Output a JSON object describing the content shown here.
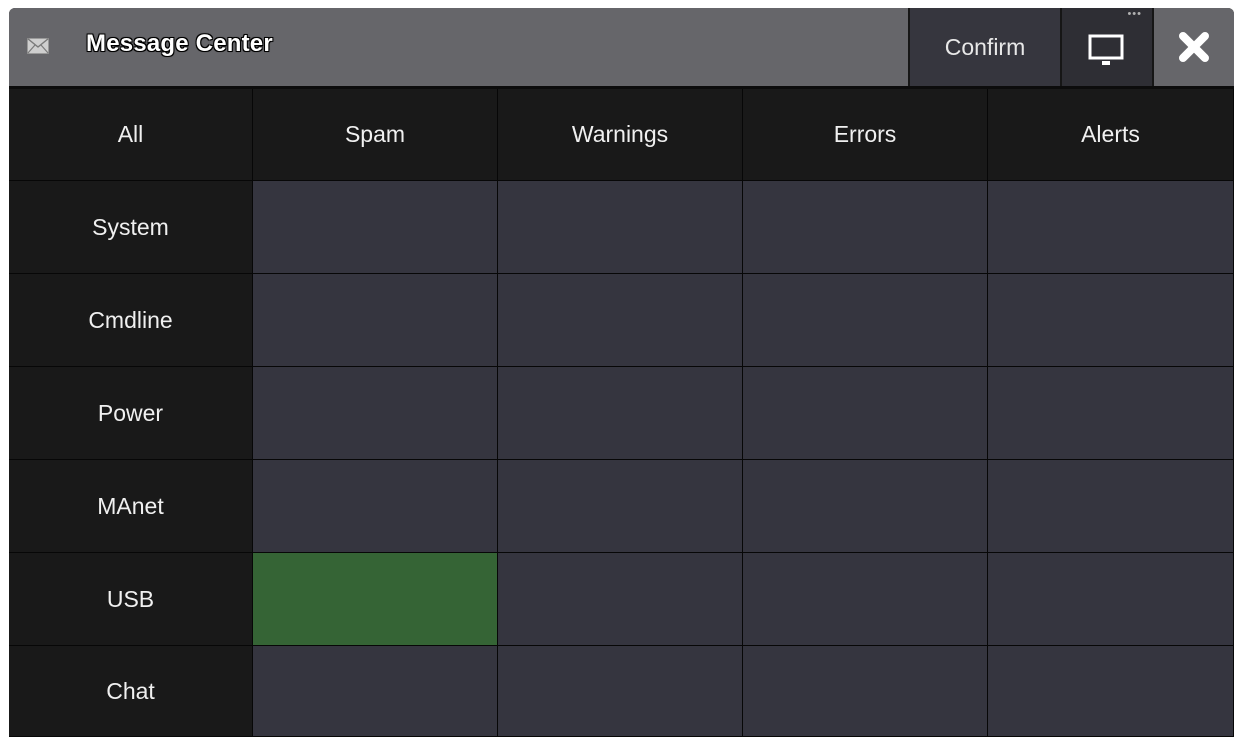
{
  "window": {
    "title": "Message Center",
    "confirm_label": "Confirm",
    "title_icon": "envelope-icon",
    "display_icon": "monitor-icon",
    "close_icon": "close-icon",
    "dots_label": "•••"
  },
  "colors": {
    "titlebar": "#66666a",
    "header_cell": "#191919",
    "value_cell": "#35353f",
    "enabled_cell": "#356435"
  },
  "matrix": {
    "corner_label": "All",
    "columns": [
      "Spam",
      "Warnings",
      "Errors",
      "Alerts"
    ],
    "rows": [
      {
        "label": "System",
        "cells": [
          false,
          false,
          false,
          false
        ]
      },
      {
        "label": "Cmdline",
        "cells": [
          false,
          false,
          false,
          false
        ]
      },
      {
        "label": "Power",
        "cells": [
          false,
          false,
          false,
          false
        ]
      },
      {
        "label": "MAnet",
        "cells": [
          false,
          false,
          false,
          false
        ]
      },
      {
        "label": "USB",
        "cells": [
          true,
          false,
          false,
          false
        ]
      },
      {
        "label": "Chat",
        "cells": [
          false,
          false,
          false,
          false
        ]
      }
    ]
  }
}
